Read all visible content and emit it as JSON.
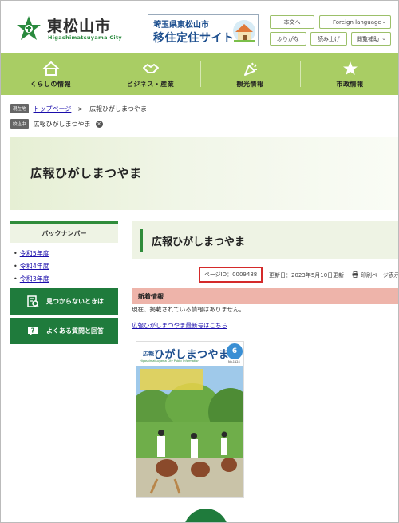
{
  "header": {
    "logo_name": "東松山市",
    "logo_roman": "Higashimatsuyama City",
    "banner_line1": "埼玉県東松山市",
    "banner_line2": "移住定住サイト",
    "buttons": {
      "skip": "本文へ",
      "language": "Foreign language",
      "furigana": "ふりがな",
      "read_aloud": "読み上げ",
      "accessibility": "閲覧補助"
    }
  },
  "nav": [
    {
      "label": "くらしの情報",
      "icon": "house-icon"
    },
    {
      "label": "ビジネス・産業",
      "icon": "handshake-icon"
    },
    {
      "label": "観光情報",
      "icon": "party-popper-icon"
    },
    {
      "label": "市政情報",
      "icon": "city-emblem-icon"
    }
  ],
  "breadcrumb": {
    "current_tag": "現在地",
    "home": "トップページ",
    "separator": ">",
    "current": "広報ひがしまつやま",
    "filter_tag": "絞込中",
    "filter_value": "広報ひがしまつやま"
  },
  "hero": {
    "title": "広報ひがしまつやま"
  },
  "sidebar": {
    "heading": "バックナンバー",
    "links": [
      "令和5年度",
      "令和4年度",
      "令和3年度"
    ],
    "help_button": "見つからないときは",
    "faq_button": "よくある質問と回答"
  },
  "main": {
    "title": "広報ひがしまつやま",
    "page_id": "ページID：0009488",
    "updated": "更新日：2023年5月10日更新",
    "print": "印刷ページ表示",
    "news_heading": "新着情報",
    "news_empty": "現在、掲載されている情報はありません。",
    "latest_link": "広報ひがしまつやま最新号はこちら"
  },
  "cover": {
    "koho": "広報",
    "name": "ひがしまつやま",
    "issue": "6",
    "subtitle": "Higashimatsuyama City Public Information",
    "number": "No.1124"
  },
  "colors": {
    "nav_green": "#a9cd64",
    "accent_green": "#2f8c3a",
    "button_green": "#1f7b3c",
    "news_pink": "#eeb4aa",
    "highlight_red": "#d42a2a"
  }
}
